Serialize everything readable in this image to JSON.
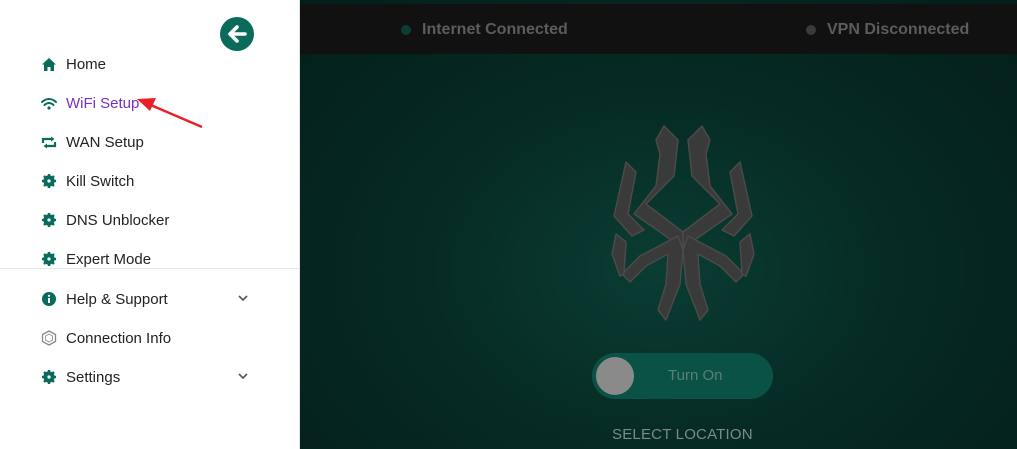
{
  "sidebar": {
    "back_icon": "arrow-left-circle-icon",
    "items": [
      {
        "label": "Home",
        "icon": "home-icon"
      },
      {
        "label": "WiFi Setup",
        "icon": "wifi-icon",
        "active": true
      },
      {
        "label": "WAN Setup",
        "icon": "refresh-icon"
      },
      {
        "label": "Kill Switch",
        "icon": "gear-icon"
      },
      {
        "label": "DNS Unblocker",
        "icon": "gear-icon"
      },
      {
        "label": "Expert Mode",
        "icon": "gear-icon"
      }
    ],
    "secondary_items": [
      {
        "label": "Help & Support",
        "icon": "info-icon",
        "expandable": true
      },
      {
        "label": "Connection Info",
        "icon": "hexagon-icon"
      },
      {
        "label": "Settings",
        "icon": "gear-icon",
        "expandable": true
      }
    ]
  },
  "status_bar": {
    "internet": {
      "label": "Internet Connected",
      "dot_color": "#0b3d34"
    },
    "vpn": {
      "label": "VPN Disconnected",
      "dot_color": "#3a3a3a"
    }
  },
  "main": {
    "logo_icon": "expressvpn-spider-logo-icon",
    "toggle_label": "Turn On",
    "toggle_state": "off",
    "select_location_label": "SELECT LOCATION"
  },
  "colors": {
    "accent": "#0a6b5b",
    "active_nav": "#7b2fbe",
    "annotation": "#e8202a"
  }
}
